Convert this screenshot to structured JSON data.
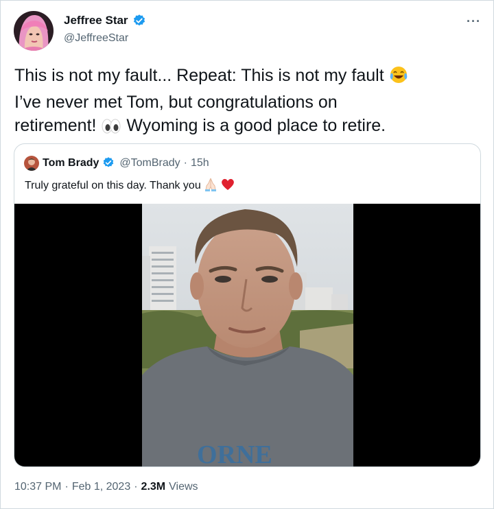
{
  "author": {
    "name": "Jeffree Star",
    "handle": "@JeffreeStar",
    "verified": true,
    "avatar_icon": "jeffree-star-avatar"
  },
  "more_menu": {
    "label": "···",
    "icon": "more-horizontal-icon"
  },
  "tweet": {
    "lines": [
      "This is not my fault... Repeat: This is not my fault",
      "I’ve never met Tom, but congratulations on",
      "retirement!",
      "Wyoming is a good place to retire."
    ],
    "emojis": [
      "face-with-tears-of-joy-icon",
      "eyes-icon"
    ]
  },
  "quoted_tweet": {
    "name": "Tom Brady",
    "handle": "@TomBrady",
    "separator": "·",
    "time": "15h",
    "text": "Truly grateful on this day. Thank you",
    "emojis": [
      "folded-hands-icon",
      "red-heart-icon"
    ],
    "media": "video-still-tom-brady-beach",
    "shirt_text": "ORNE"
  },
  "footer": {
    "time": "10:37 PM",
    "separator": "·",
    "date": "Feb 1, 2023",
    "views_count": "2.3M",
    "views_label": "Views"
  },
  "colors": {
    "verified_blue": "#1d9bf0",
    "secondary_text": "#536471",
    "border": "#cfd9de",
    "primary_text": "#0f1419"
  }
}
